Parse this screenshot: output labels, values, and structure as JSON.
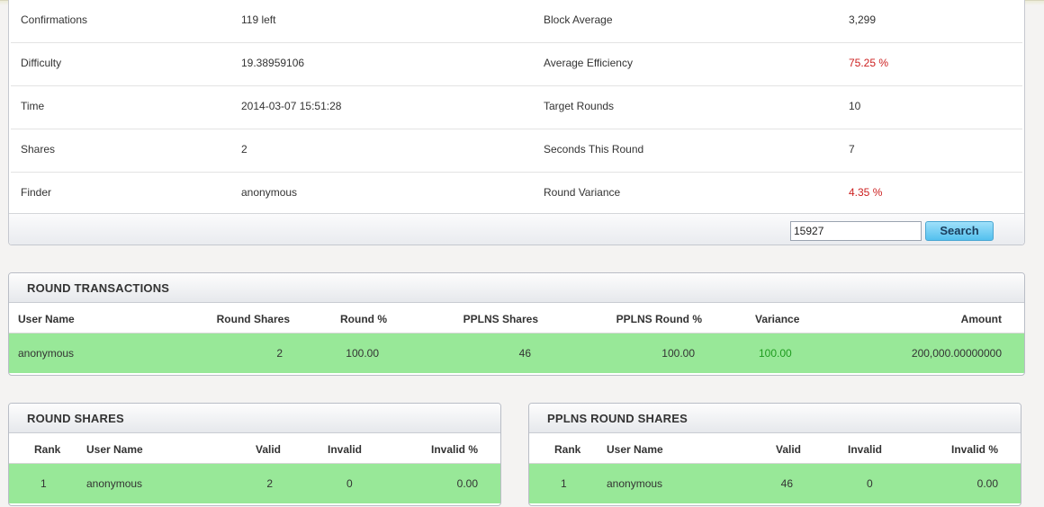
{
  "details": {
    "rows": [
      {
        "label1": "Confirmations",
        "value1": "119 left",
        "label2": "Block Average",
        "value2": "3,299"
      },
      {
        "label1": "Difficulty",
        "value1": "19.38959106",
        "label2": "Average Efficiency",
        "value2": "75.25 %"
      },
      {
        "label1": "Time",
        "value1": "2014-03-07 15:51:28",
        "label2": "Target Rounds",
        "value2": "10"
      },
      {
        "label1": "Shares",
        "value1": "2",
        "label2": "Seconds This Round",
        "value2": "7"
      },
      {
        "label1": "Finder",
        "value1": "anonymous",
        "label2": "Round Variance",
        "value2": "4.35 %"
      }
    ],
    "search": {
      "value": "15927",
      "button_label": "Search"
    }
  },
  "round_transactions": {
    "title": "ROUND TRANSACTIONS",
    "columns": [
      "User Name",
      "Round Shares",
      "Round %",
      "PPLNS Shares",
      "PPLNS Round %",
      "Variance",
      "Amount"
    ],
    "rows": [
      {
        "user": "anonymous",
        "round_shares": "2",
        "round_pct": "100.00",
        "pplns_shares": "46",
        "pplns_round_pct": "100.00",
        "variance": "100.00",
        "amount": "200,000.00000000"
      }
    ]
  },
  "round_shares": {
    "title": "ROUND SHARES",
    "columns": [
      "Rank",
      "User Name",
      "Valid",
      "Invalid",
      "Invalid %"
    ],
    "rows": [
      {
        "rank": "1",
        "user": "anonymous",
        "valid": "2",
        "invalid": "0",
        "invalid_pct": "0.00"
      }
    ]
  },
  "pplns_round_shares": {
    "title": "PPLNS ROUND SHARES",
    "columns": [
      "Rank",
      "User Name",
      "Valid",
      "Invalid",
      "Invalid %"
    ],
    "rows": [
      {
        "rank": "1",
        "user": "anonymous",
        "valid": "46",
        "invalid": "0",
        "invalid_pct": "0.00"
      }
    ]
  },
  "colors": {
    "value_red": "#cc1f1f",
    "variance_green": "#1f9c1f",
    "row_green": "#98e898",
    "button_blue": "#53c0ee"
  }
}
